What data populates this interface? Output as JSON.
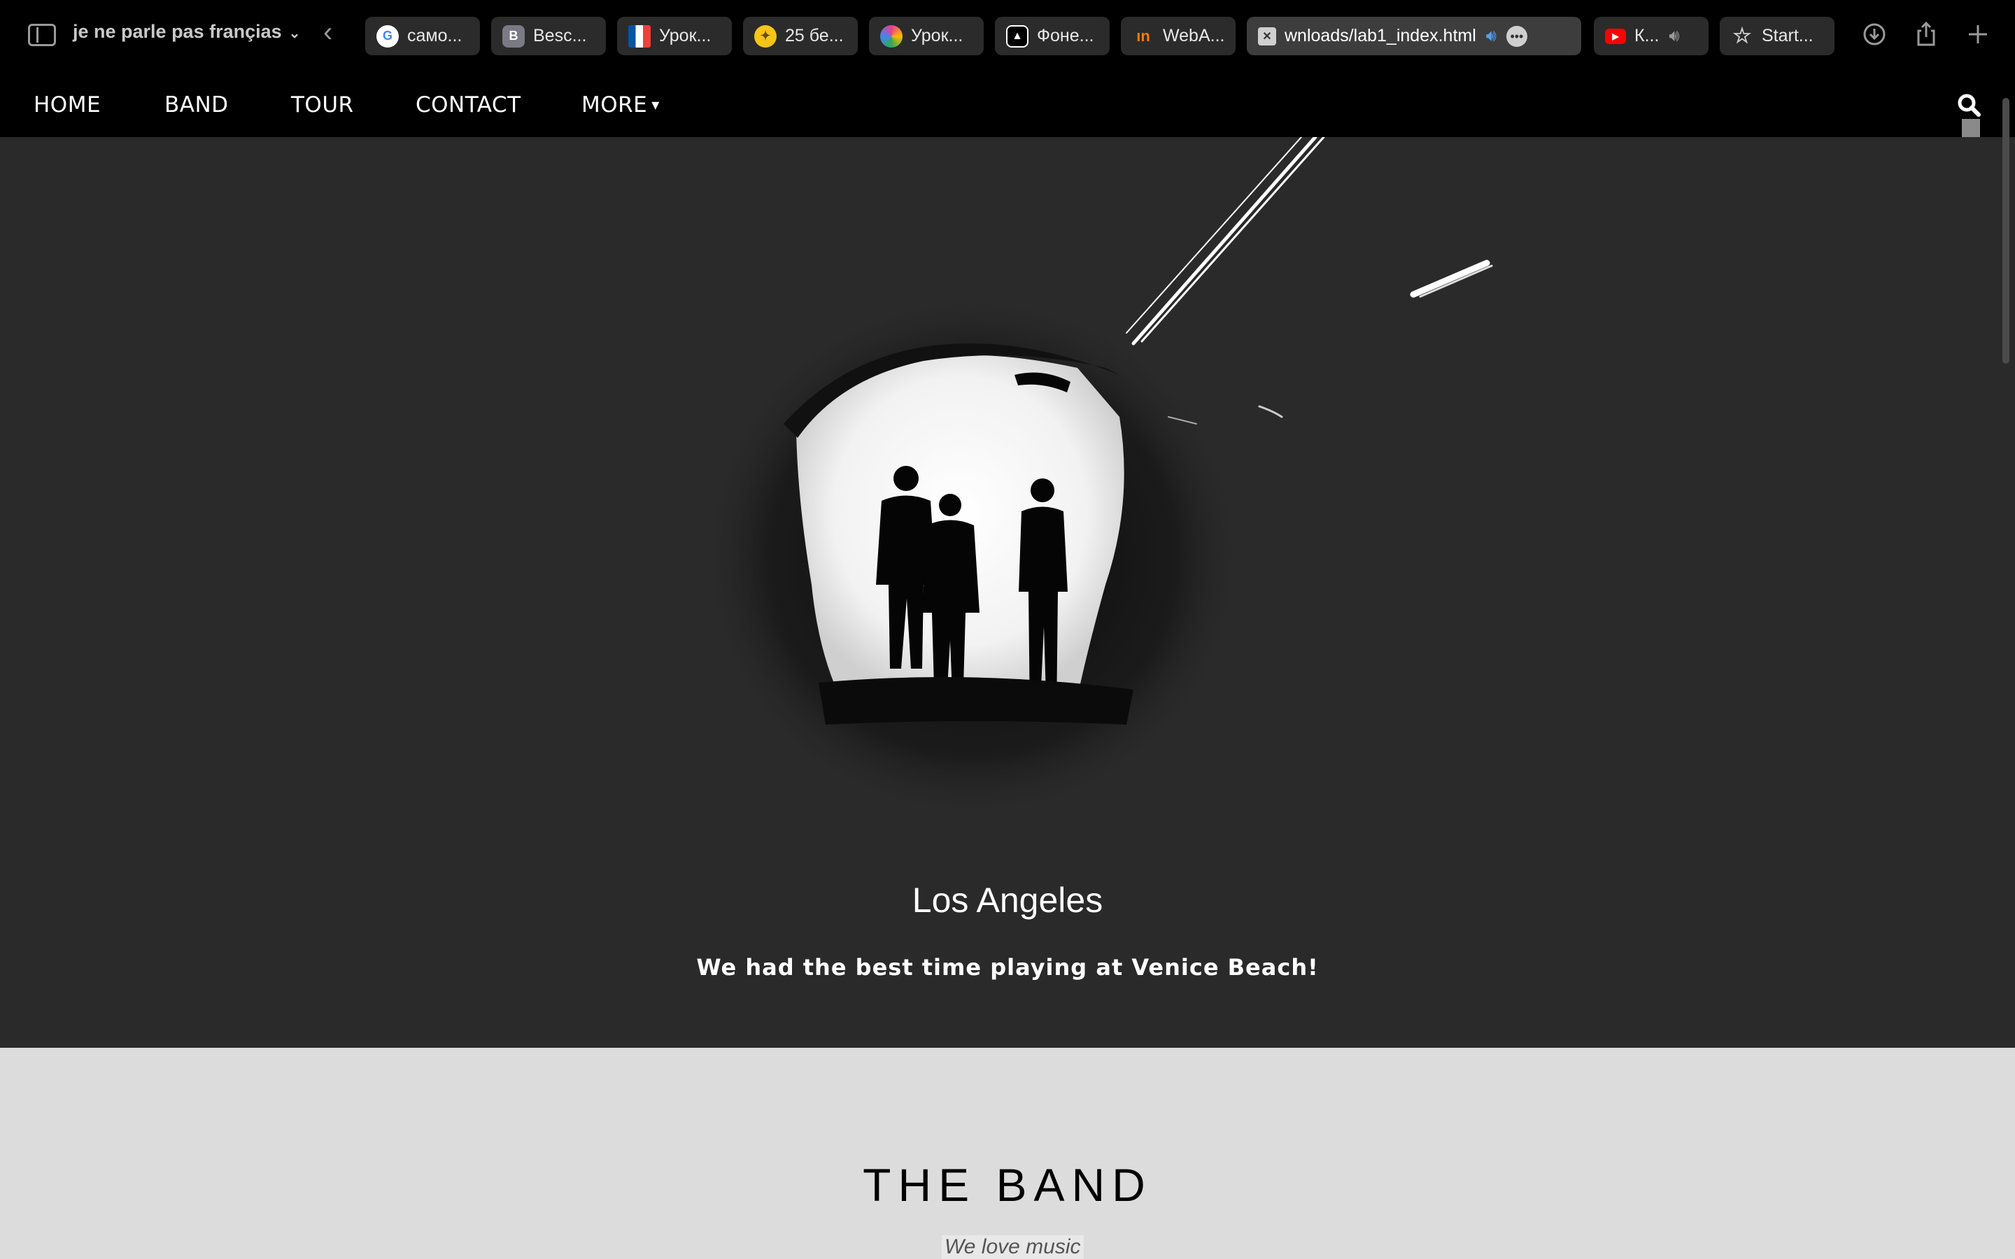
{
  "browser": {
    "tab_group": "je ne parle pas françias",
    "tabs": [
      {
        "label": "само...",
        "icon": "google-icon",
        "color": "#ffffff"
      },
      {
        "label": "Besc...",
        "icon": "b-letter-icon",
        "color": "#7a7a86"
      },
      {
        "label": "Урок...",
        "icon": "french-flag-icon",
        "color": "#0055a4"
      },
      {
        "label": "25 бе...",
        "icon": "bulb-icon",
        "color": "#f5c518"
      },
      {
        "label": "Урок...",
        "icon": "pinwheel-icon",
        "color": "#e83e8c"
      },
      {
        "label": "Фоне...",
        "icon": "triangle-a-icon",
        "color": "#ffffff"
      },
      {
        "label": "WebA...",
        "icon": "in-logo-icon",
        "color": "#ff7a00"
      },
      {
        "label": "wnloads/lab1_index.html",
        "icon": "close-icon",
        "color": "#cfcfcf",
        "active": true
      },
      {
        "label": "К...",
        "icon": "youtube-icon",
        "color": "#ff0000"
      },
      {
        "label": "Start...",
        "icon": "star-icon",
        "color": "#cfcfcf"
      }
    ]
  },
  "nav": {
    "items": [
      "HOME",
      "BAND",
      "TOUR",
      "CONTACT",
      "MORE"
    ],
    "more_caret": "▾"
  },
  "hero": {
    "title": "Los Angeles",
    "text": "We had the best time playing at Venice Beach!"
  },
  "band": {
    "title": "THE BAND",
    "subtitle": "We love music"
  },
  "colors": {
    "nav_bg": "#000000",
    "hero_bg": "#2a2a2a",
    "band_bg": "#dcdcdc"
  }
}
